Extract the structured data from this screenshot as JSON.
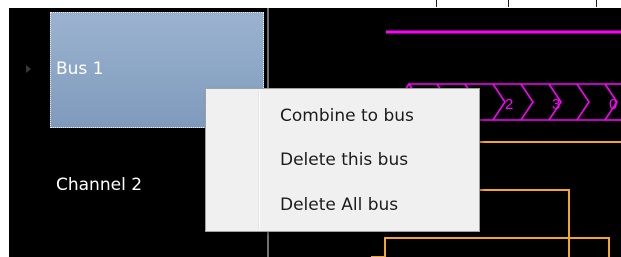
{
  "colors": {
    "panel_bg": "#000000",
    "selected_bus": "#8ea7c6",
    "bus_wave": "#ff00ff",
    "channel_wave": "#f5a623",
    "menu_bg": "#f0f0f0",
    "label_text": "#ffffff"
  },
  "rows": {
    "bus": {
      "label": "Bus 1",
      "selected": true
    },
    "channel": {
      "label": "Channel 2"
    }
  },
  "bus_waveform": {
    "values": [
      "2",
      "3",
      "0"
    ]
  },
  "context_menu": {
    "items": [
      {
        "label": "Combine to bus"
      },
      {
        "label": "Delete this bus"
      },
      {
        "label": "Delete All bus"
      }
    ]
  },
  "icons": {
    "row_expander": "triangle-right-icon"
  }
}
